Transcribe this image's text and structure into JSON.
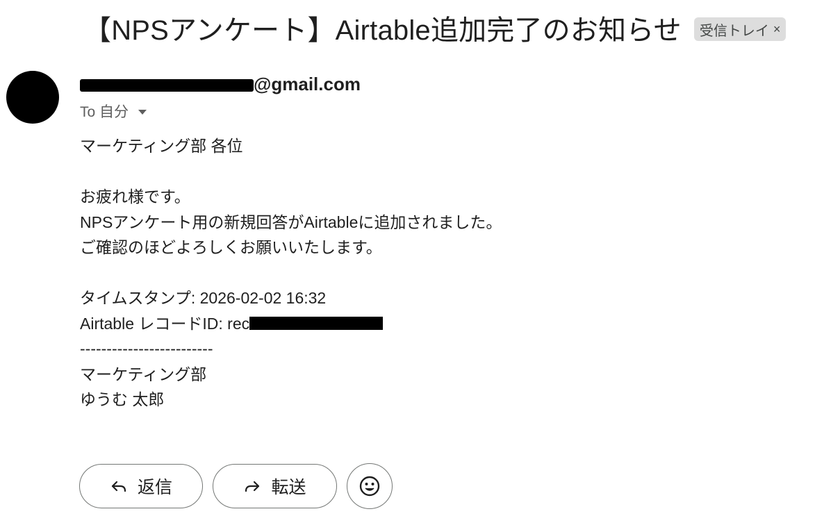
{
  "subject": "【NPSアンケート】Airtable追加完了のお知らせ",
  "label_chip": {
    "text": "受信トレイ",
    "close": "×"
  },
  "sender": {
    "email_suffix": "@gmail.com"
  },
  "recipient": {
    "text": "To 自分"
  },
  "body": {
    "greeting": "マーケティング部 各位",
    "line1": "お疲れ様です。",
    "line2": "NPSアンケート用の新規回答がAirtableに追加されました。",
    "line3": "ご確認のほどよろしくお願いいたします。",
    "timestamp": "タイムスタンプ: 2026-02-02 16:32",
    "record_id_prefix": "Airtable レコードID: rec",
    "divider": "-------------------------",
    "sig_department": "マーケティング部",
    "sig_name": "ゆうむ 太郎"
  },
  "actions": {
    "reply_label": "返信",
    "forward_label": "転送"
  },
  "icons": {
    "reply": "reply-arrow-icon",
    "forward": "forward-arrow-icon",
    "emoji": "emoji-reaction-icon",
    "dropdown": "caret-down-icon"
  },
  "colors": {
    "avatar": "#000000",
    "chip_bg": "#dddddd",
    "muted_text": "#5e5e5e",
    "button_border": "#747775"
  }
}
